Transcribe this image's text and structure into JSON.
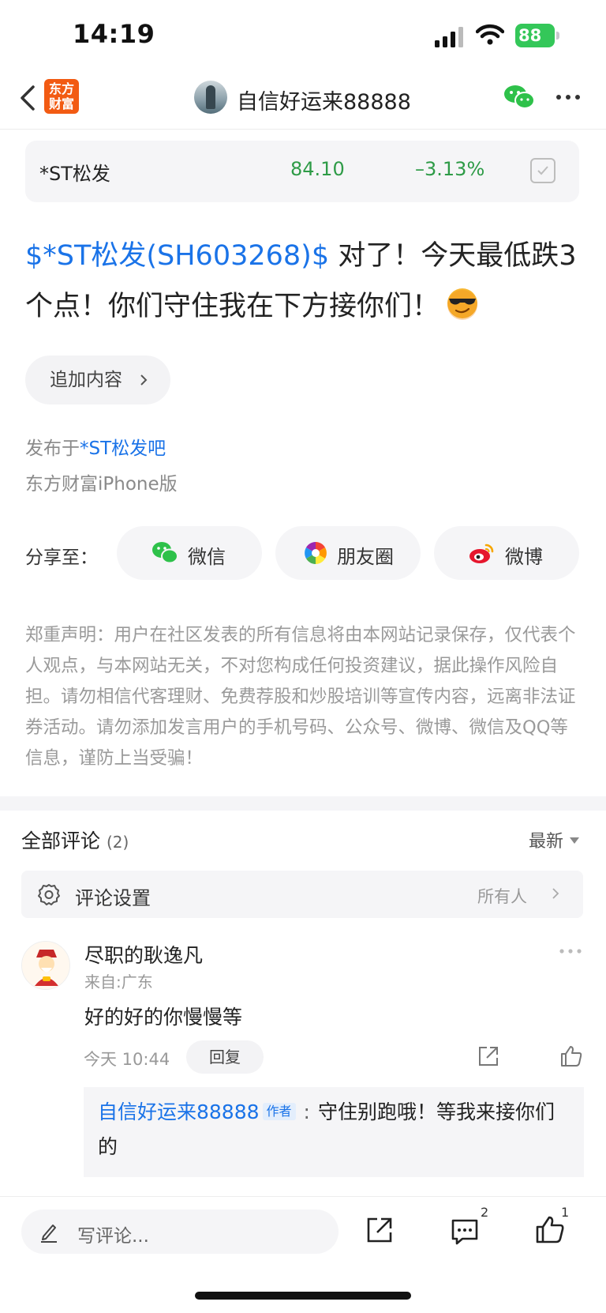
{
  "status_bar": {
    "time": "14:19",
    "battery": "88"
  },
  "nav": {
    "logo_text_1": "东方",
    "logo_text_2": "财富",
    "title": "自信好运来88888"
  },
  "stock": {
    "name": "*ST松发",
    "price": "84.10",
    "change": "–3.13%"
  },
  "post": {
    "link": "$*ST松发(SH603268)$",
    "text": " 对了！今天最低跌3个点！你们守住我在下方接你们！"
  },
  "add_content": "追加内容",
  "published": {
    "prefix": "发布于",
    "bar": "*ST松发吧",
    "client": "东方财富iPhone版"
  },
  "share": {
    "label": "分享至：",
    "items": [
      {
        "label": "微信",
        "icon": "wechat-icon"
      },
      {
        "label": "朋友圈",
        "icon": "moments-icon"
      },
      {
        "label": "微博",
        "icon": "weibo-icon"
      }
    ]
  },
  "disclaimer": "郑重声明：用户在社区发表的所有信息将由本网站记录保存，仅代表个人观点，与本网站无关，不对您构成任何投资建议，据此操作风险自担。请勿相信代客理财、免费荐股和炒股培训等宣传内容，远离非法证券活动。请勿添加发言用户的手机号码、公众号、微博、微信及QQ等信息，谨防上当受骗！",
  "comments": {
    "title": "全部评论",
    "count": "(2)",
    "sort": "最新",
    "settings_label": "评论设置",
    "settings_value": "所有人",
    "items": [
      {
        "name": "尽职的耿逸凡",
        "location": "来自:广东",
        "text": "好的好的你慢慢等",
        "time": "今天 10:44",
        "reply_label": "回复",
        "reply": {
          "author": "自信好运来88888",
          "badge": "作者",
          "colon": ":",
          "text": "守住别跑哦！等我来接你们的"
        }
      }
    ]
  },
  "bottom_bar": {
    "placeholder": "写评论...",
    "comment_count": "2",
    "like_count": "1"
  },
  "colors": {
    "accent_blue": "#1a73e8",
    "down_green": "#2e9b47",
    "brand_orange": "#f25b13"
  }
}
